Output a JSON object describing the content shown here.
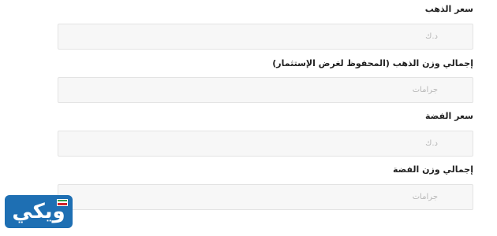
{
  "fields": [
    {
      "label": "سعر الذهب",
      "placeholder": "د.ك"
    },
    {
      "label": "إجمالي وزن الذهب (المحفوظ لغرض الإستثمار)",
      "placeholder": "جرامات"
    },
    {
      "label": "سعر الفضة",
      "placeholder": "د.ك"
    },
    {
      "label": "إجمالي وزن الفضة",
      "placeholder": "جرامات"
    }
  ],
  "logo": {
    "text": "ويكي",
    "flag_colors": [
      "#2e9b47",
      "#ffffff",
      "#d2232a"
    ]
  }
}
